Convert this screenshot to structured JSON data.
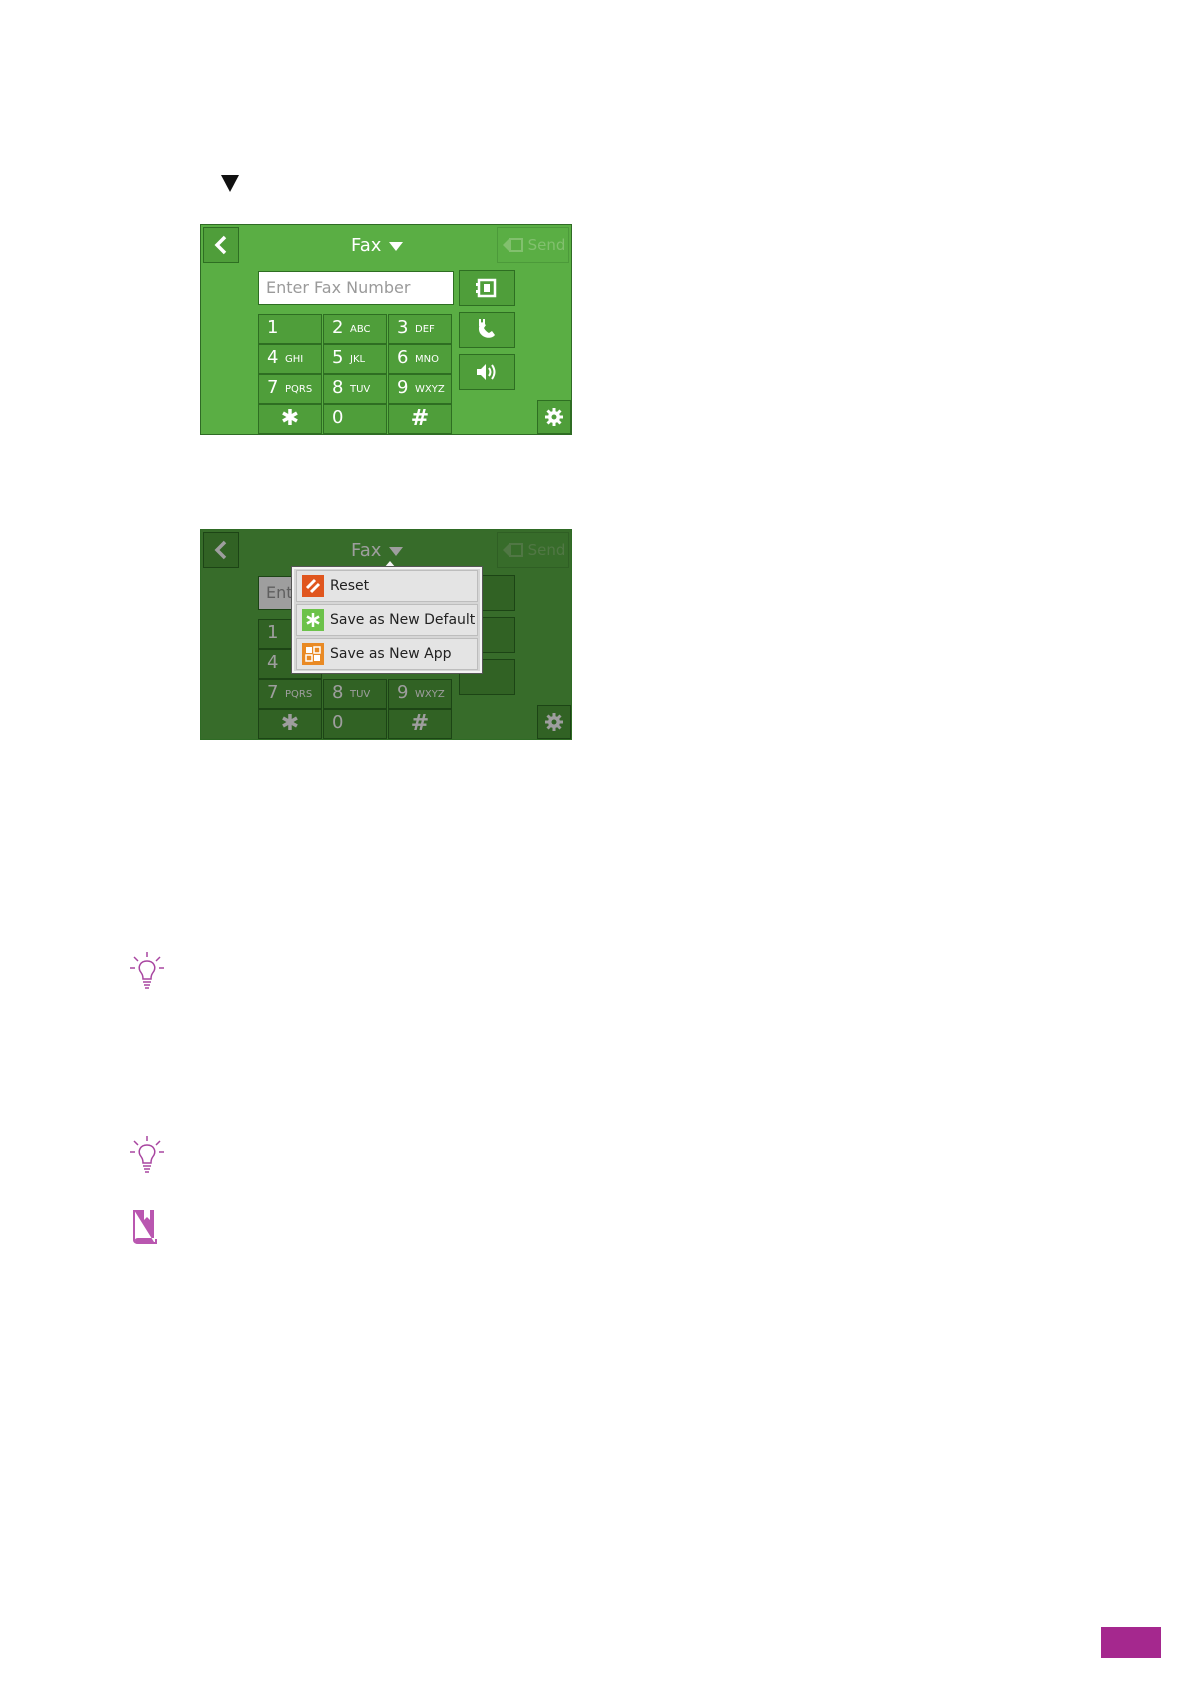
{
  "colors": {
    "panel_green": "#5aae44",
    "accent_purple": "#a5288e"
  },
  "panel1": {
    "title": "Fax",
    "send_label": "Send",
    "input_placeholder": "Enter Fax Number",
    "keys": [
      {
        "digit": "1",
        "letters": ""
      },
      {
        "digit": "2",
        "letters": "ABC"
      },
      {
        "digit": "3",
        "letters": "DEF"
      },
      {
        "digit": "4",
        "letters": "GHI"
      },
      {
        "digit": "5",
        "letters": "JKL"
      },
      {
        "digit": "6",
        "letters": "MNO"
      },
      {
        "digit": "7",
        "letters": "PQRS"
      },
      {
        "digit": "8",
        "letters": "TUV"
      },
      {
        "digit": "9",
        "letters": "WXYZ"
      },
      {
        "digit": "✱",
        "letters": ""
      },
      {
        "digit": "0",
        "letters": ""
      },
      {
        "digit": "#",
        "letters": ""
      }
    ]
  },
  "panel2": {
    "title": "Fax",
    "send_label": "Send",
    "input_partial": "Ent",
    "menu": [
      {
        "label": "Reset",
        "icon": "reset-icon"
      },
      {
        "label": "Save as New Default",
        "icon": "save-default-icon"
      },
      {
        "label": "Save as New App",
        "icon": "save-app-icon"
      }
    ]
  }
}
